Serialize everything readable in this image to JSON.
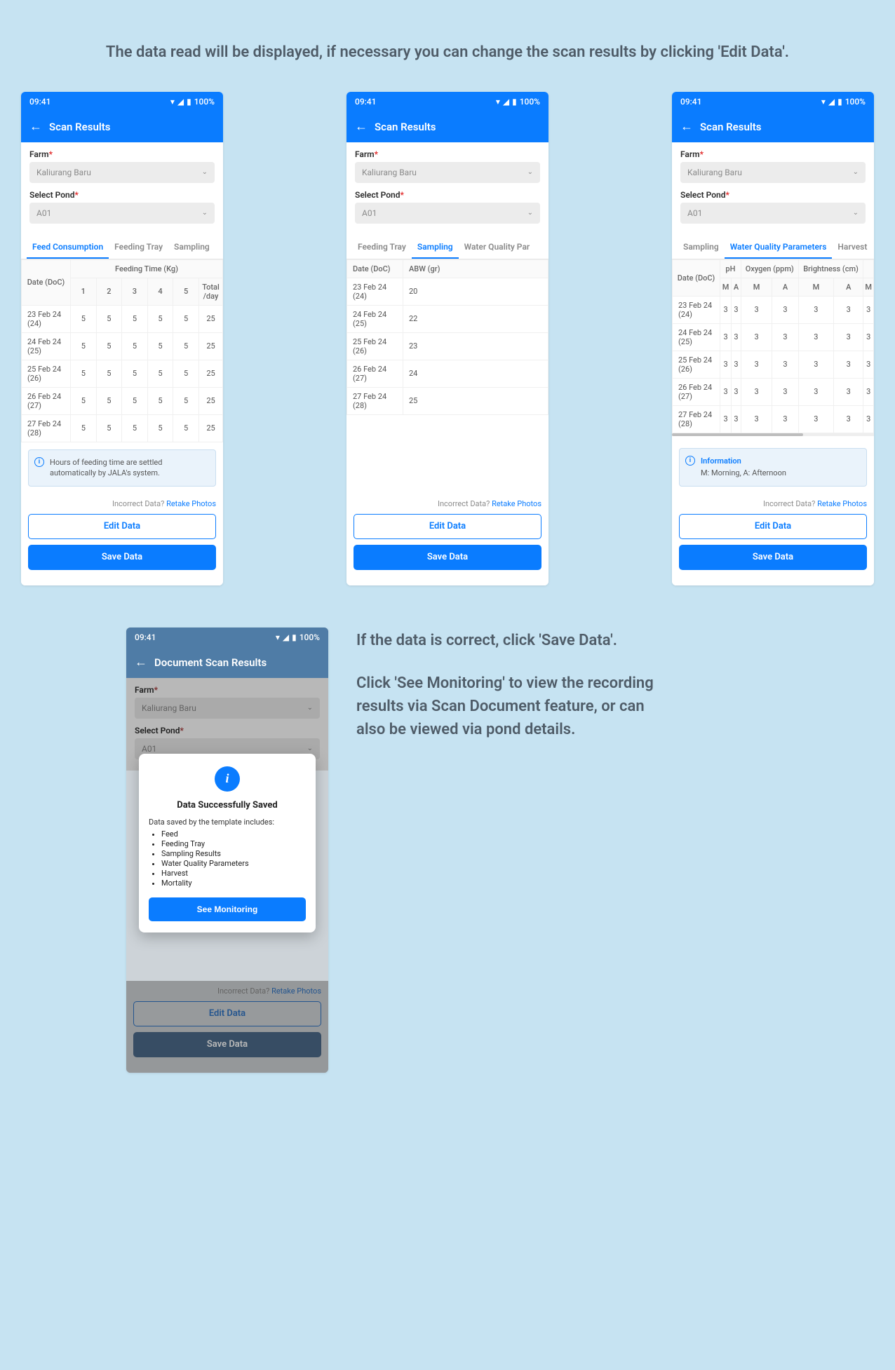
{
  "intro_text_1": "The data read will be displayed, if necessary you can change the scan results by clicking 'Edit Data'.",
  "intro_text_2a": "If the data is correct, click 'Save Data'.",
  "intro_text_2b": "Click 'See Monitoring' to view the recording results via Scan Document feature, or can also be viewed via pond details.",
  "status": {
    "time": "09:41",
    "battery": "100%"
  },
  "header": {
    "title": "Scan Results",
    "title_alt": "Document Scan Results"
  },
  "form": {
    "farm_label": "Farm",
    "farm_value": "Kaliurang Baru",
    "pond_label": "Select Pond",
    "pond_value": "A01"
  },
  "tabs_all": [
    "Feed Consumption",
    "Feeding Tray",
    "Sampling",
    "Water Quality Parameters",
    "Harvest"
  ],
  "screen1": {
    "tabs": [
      "Feed Consumption",
      "Feeding Tray",
      "Sampling"
    ],
    "active": 0,
    "super_header": "Feeding Time (Kg)",
    "date_col": "Date (DoC)",
    "cols": [
      "1",
      "2",
      "3",
      "4",
      "5",
      "Total /day"
    ],
    "rows": [
      {
        "d": "23 Feb 24 (24)",
        "v": [
          "5",
          "5",
          "5",
          "5",
          "5",
          "25"
        ]
      },
      {
        "d": "24 Feb 24 (25)",
        "v": [
          "5",
          "5",
          "5",
          "5",
          "5",
          "25"
        ]
      },
      {
        "d": "25 Feb 24 (26)",
        "v": [
          "5",
          "5",
          "5",
          "5",
          "5",
          "25"
        ]
      },
      {
        "d": "26 Feb 24 (27)",
        "v": [
          "5",
          "5",
          "5",
          "5",
          "5",
          "25"
        ]
      },
      {
        "d": "27 Feb 24 (28)",
        "v": [
          "5",
          "5",
          "5",
          "5",
          "5",
          "25"
        ]
      }
    ],
    "info": "Hours of feeding time are settled automatically by JALA's system."
  },
  "screen2": {
    "tabs": [
      "Feeding Tray",
      "Sampling",
      "Water Quality Par"
    ],
    "active": 1,
    "date_col": "Date (DoC)",
    "col": "ABW (gr)",
    "rows": [
      {
        "d": "23 Feb 24 (24)",
        "v": "20"
      },
      {
        "d": "24 Feb 24 (25)",
        "v": "22"
      },
      {
        "d": "25 Feb 24 (26)",
        "v": "23"
      },
      {
        "d": "26 Feb 24 (27)",
        "v": "24"
      },
      {
        "d": "27 Feb 24 (28)",
        "v": "25"
      }
    ]
  },
  "screen3": {
    "tabs": [
      "Sampling",
      "Water Quality Parameters",
      "Harvest"
    ],
    "active": 1,
    "date_col": "Date (DoC)",
    "groups": [
      "pH",
      "Oxygen (ppm)",
      "Brightness (cm)"
    ],
    "sub": [
      "M",
      "A"
    ],
    "extra_sub": "M",
    "rows": [
      {
        "d": "23 Feb 24 (24)",
        "v": [
          "3",
          "3",
          "3",
          "3",
          "3",
          "3",
          "3"
        ]
      },
      {
        "d": "24 Feb 24 (25)",
        "v": [
          "3",
          "3",
          "3",
          "3",
          "3",
          "3",
          "3"
        ]
      },
      {
        "d": "25 Feb 24 (26)",
        "v": [
          "3",
          "3",
          "3",
          "3",
          "3",
          "3",
          "3"
        ]
      },
      {
        "d": "26 Feb 24 (27)",
        "v": [
          "3",
          "3",
          "3",
          "3",
          "3",
          "3",
          "3"
        ]
      },
      {
        "d": "27 Feb 24 (28)",
        "v": [
          "3",
          "3",
          "3",
          "3",
          "3",
          "3",
          "3"
        ]
      }
    ],
    "info_title": "Information",
    "info_body": "M: Morning, A: Afternoon"
  },
  "footer": {
    "incorrect": "Incorrect Data?",
    "retake": "Retake Photos",
    "edit": "Edit Data",
    "save": "Save Data"
  },
  "modal": {
    "title": "Data Successfully Saved",
    "lead": "Data saved by the template includes:",
    "items": [
      "Feed",
      "Feeding Tray",
      "Sampling Results",
      "Water Quality Parameters",
      "Harvest",
      "Mortality"
    ],
    "cta": "See Monitoring"
  }
}
